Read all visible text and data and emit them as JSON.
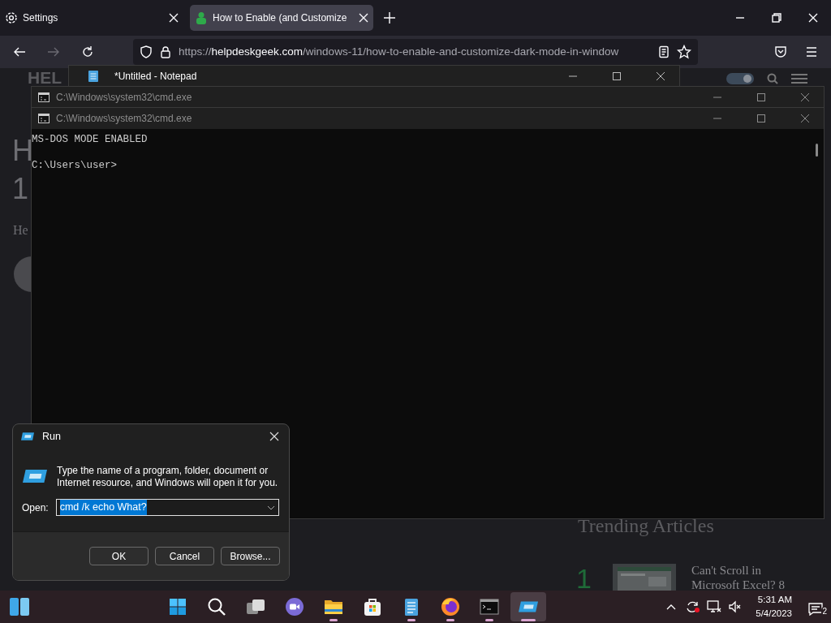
{
  "browser": {
    "tabs": [
      {
        "label": "Settings",
        "selected": false
      },
      {
        "label": "How to Enable (and Customize",
        "selected": true
      }
    ],
    "url": {
      "scheme": "https://",
      "domain": "helpdeskgeek.com",
      "path": "/windows-11/how-to-enable-and-customize-dark-mode-in-window"
    }
  },
  "page": {
    "logo": "HEL",
    "heading_fragments": [
      "H",
      "1"
    ],
    "byline_fragment": "He",
    "trending": {
      "title": "Trending Articles",
      "rank": "1",
      "article_title": "Can't Scroll in Microsoft Excel? 8"
    }
  },
  "windows": [
    {
      "kind": "notepad",
      "title": "*Untitled - Notepad",
      "active": true
    },
    {
      "kind": "cmd",
      "title": "C:\\Windows\\system32\\cmd.exe",
      "active": false
    },
    {
      "kind": "cmd",
      "title": "C:\\Windows\\system32\\cmd.exe",
      "active": false,
      "lines": [
        "MS-DOS MODE ENABLED",
        "C:\\Users\\user>"
      ]
    }
  ],
  "run_dialog": {
    "title": "Run",
    "description": "Type the name of a program, folder, document or Internet resource, and Windows will open it for you.",
    "open_label": "Open:",
    "value": "cmd /k echo What?",
    "buttons": [
      "OK",
      "Cancel",
      "Browse..."
    ]
  },
  "taskbar": {
    "apps": [
      {
        "kind": "start",
        "running": false,
        "selected": false
      },
      {
        "kind": "search",
        "running": false,
        "selected": false
      },
      {
        "kind": "task-view",
        "running": false,
        "selected": false
      },
      {
        "kind": "chat",
        "running": false,
        "selected": false
      },
      {
        "kind": "explorer",
        "running": true,
        "selected": false
      },
      {
        "kind": "store",
        "running": false,
        "selected": false
      },
      {
        "kind": "notepad",
        "running": true,
        "selected": false
      },
      {
        "kind": "firefox",
        "running": true,
        "selected": false
      },
      {
        "kind": "terminal",
        "running": true,
        "selected": false
      },
      {
        "kind": "run",
        "running": true,
        "selected": true
      }
    ],
    "time": "5:31 AM",
    "date": "5/4/2023",
    "notifications": "2"
  }
}
